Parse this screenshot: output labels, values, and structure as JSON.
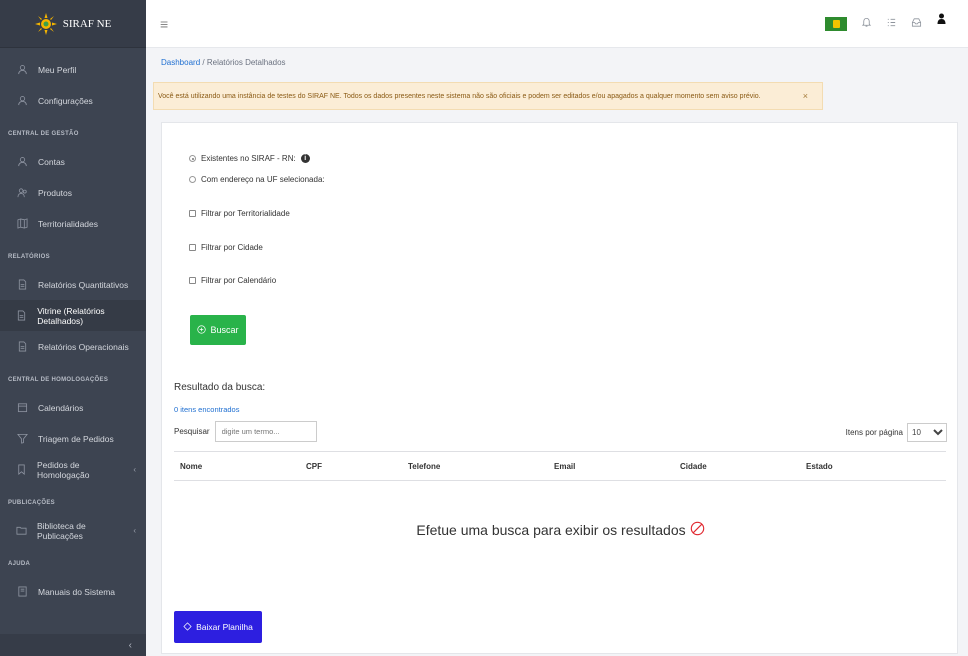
{
  "brand": {
    "name": "SIRAF NE"
  },
  "sidebar": {
    "top_items": [
      {
        "label": "Meu Perfil",
        "icon": "user-icon"
      },
      {
        "label": "Configurações",
        "icon": "user-icon"
      }
    ],
    "sections": [
      {
        "title": "CENTRAL DE GESTÃO",
        "items": [
          {
            "label": "Contas",
            "icon": "user-icon"
          },
          {
            "label": "Produtos",
            "icon": "users-icon"
          },
          {
            "label": "Territorialidades",
            "icon": "map-icon"
          }
        ]
      },
      {
        "title": "RELATÓRIOS",
        "items": [
          {
            "label": "Relatórios Quantitativos",
            "icon": "document-icon"
          },
          {
            "label": "Vitrine (Relatórios Detalhados)",
            "icon": "document-icon",
            "active": true
          },
          {
            "label": "Relatórios Operacionais",
            "icon": "document-icon"
          }
        ]
      },
      {
        "title": "CENTRAL DE HOMOLOGAÇÕES",
        "items": [
          {
            "label": "Calendários",
            "icon": "calendar-icon"
          },
          {
            "label": "Triagem de Pedidos",
            "icon": "filter-icon"
          },
          {
            "label": "Pedidos de Homologação",
            "icon": "bookmark-icon",
            "chevron": "‹"
          }
        ]
      },
      {
        "title": "PUBLICAÇÕES",
        "items": [
          {
            "label": "Biblioteca de Publicações",
            "icon": "folder-icon",
            "chevron": "‹"
          }
        ]
      },
      {
        "title": "AJUDA",
        "items": [
          {
            "label": "Manuais do Sistema",
            "icon": "book-icon"
          }
        ]
      }
    ],
    "collapse_glyph": "‹"
  },
  "breadcrumb": {
    "home": "Dashboard",
    "separator": "/",
    "current": "Relatórios Detalhados"
  },
  "alert": {
    "text": "Você está utilizando uma instância de testes do SIRAF NE. Todos os dados presentes neste sistema não são oficiais e podem ser editados e/ou apagados a qualquer momento sem aviso prévio.",
    "close": "×"
  },
  "filters": {
    "radio_existing": "Existentes no SIRAF - RN:",
    "radio_address": "Com endereço na UF selecionada:",
    "check_territory": "Filtrar por Territorialidade",
    "check_city": "Filtrar por Cidade",
    "check_calendar": "Filtrar por Calendário",
    "info_glyph": "i"
  },
  "search_button": "Buscar",
  "results": {
    "title": "Resultado da busca:",
    "count": "0 itens encontrados",
    "search_label": "Pesquisar",
    "search_placeholder": "digite um termo...",
    "per_page_label": "Itens por página",
    "per_page_value": "10",
    "columns": [
      "Nome",
      "CPF",
      "Telefone",
      "Email",
      "Cidade",
      "Estado"
    ],
    "empty_message": "Efetue uma busca para exibir os resultados"
  },
  "download_button": "Baixar Planilha",
  "colors": {
    "sidebar": "#3d4451",
    "success": "#29b34a",
    "primary": "#2d1fe0",
    "danger": "#e0262e",
    "alert_bg": "#fbedd6"
  }
}
